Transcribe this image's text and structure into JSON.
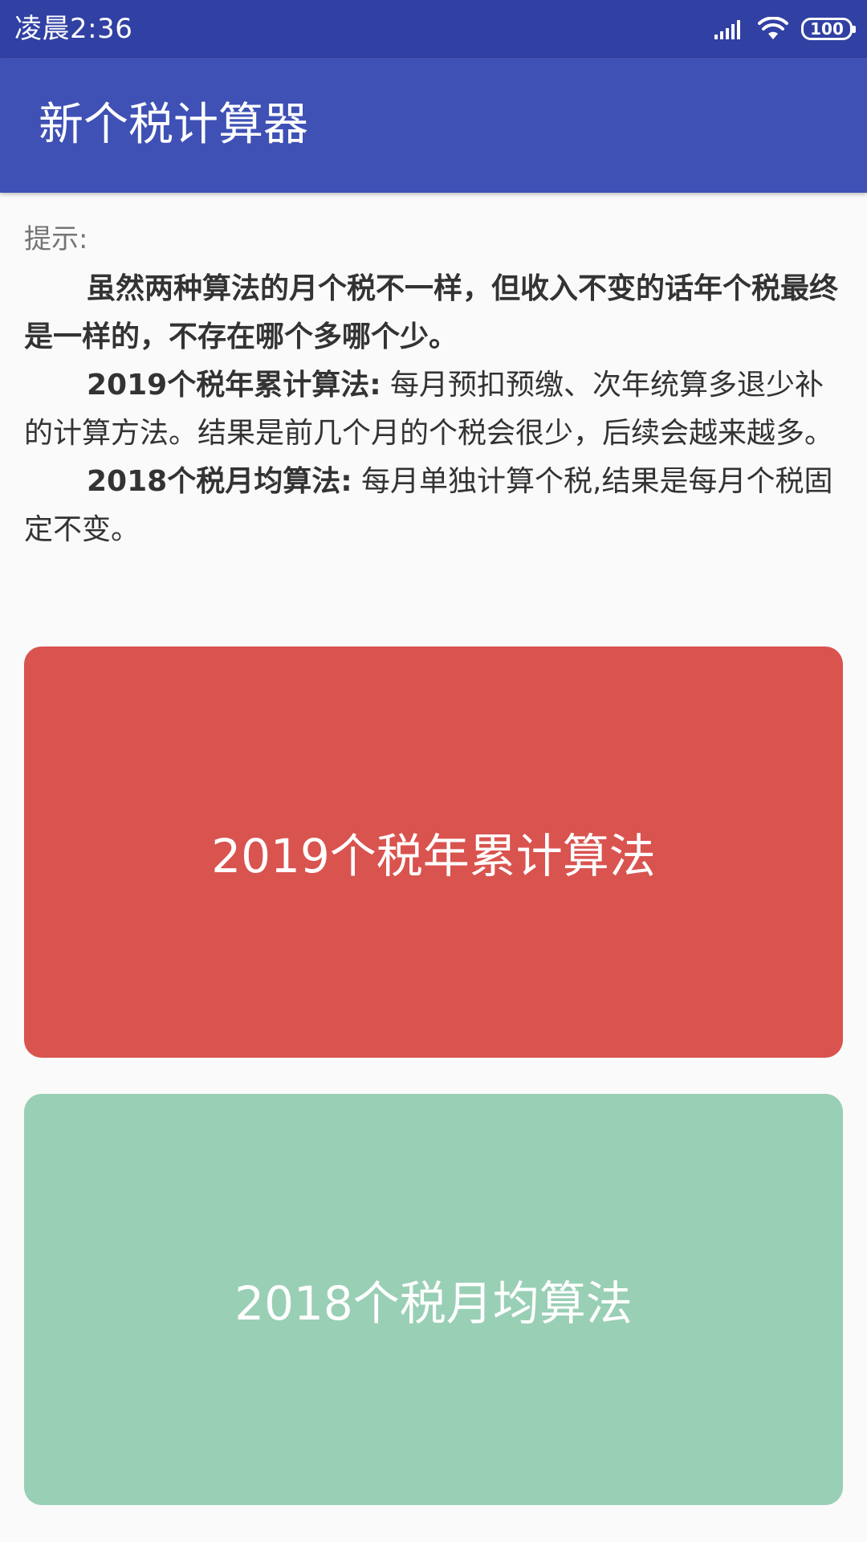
{
  "status_bar": {
    "time": "凌晨2:36",
    "battery": "100",
    "icons": [
      "signal-icon",
      "wifi-icon",
      "battery-icon"
    ]
  },
  "app_bar": {
    "title": "新个税计算器"
  },
  "tips": {
    "label": "提示:",
    "para1": "虽然两种算法的月个税不一样，但收入不变的话年个税最终是一样的，不存在哪个多哪个少。",
    "para2_title": "2019个税年累计算法:",
    "para2_text": "每月预扣预缴、次年统算多退少补的计算方法。结果是前几个月的个税会很少，后续会越来越多。",
    "para3_title": "2018个税月均算法:",
    "para3_text": "每月单独计算个税,结果是每月个税固定不变。"
  },
  "buttons": {
    "method_2019": "2019个税年累计算法",
    "method_2018": "2018个税月均算法"
  },
  "colors": {
    "status_bar": "#3140a3",
    "app_bar": "#3f51b5",
    "button_2019": "#d9534f",
    "button_2018": "#99cfb5",
    "background": "#fafafa"
  }
}
